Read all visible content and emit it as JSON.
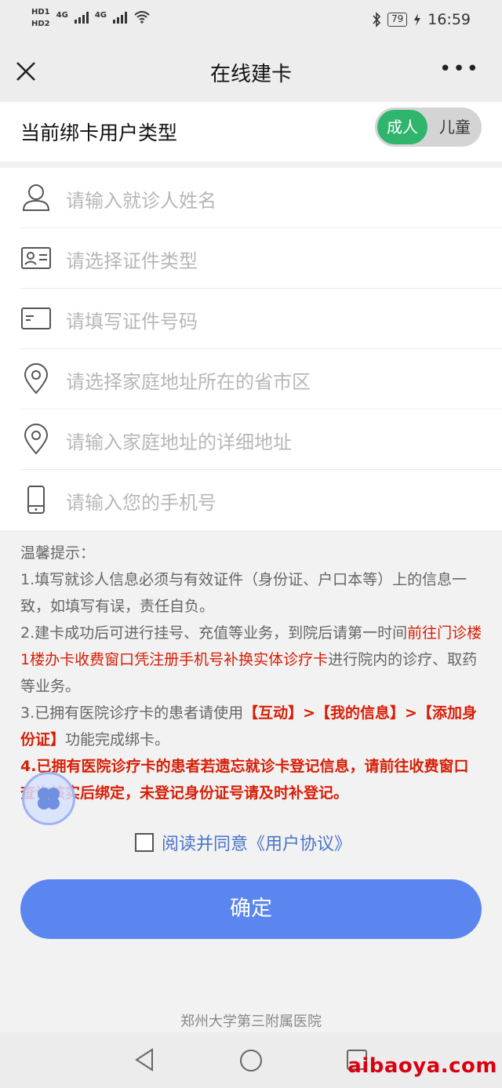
{
  "status_bar": {
    "hd1": "HD1",
    "hd2": "HD2",
    "net1": "4G",
    "net2": "4G",
    "battery": "79",
    "time": "16:59",
    "icons": [
      "signal-icon",
      "wifi-icon",
      "bluetooth-icon",
      "battery-icon",
      "charging-icon"
    ]
  },
  "nav": {
    "title": "在线建卡",
    "close_icon": "close-icon",
    "more_label": "•••"
  },
  "user_type": {
    "label": "当前绑卡用户类型",
    "options": [
      "成人",
      "儿童"
    ],
    "selected": "成人",
    "accent": "#2fb56c"
  },
  "form": {
    "fields": [
      {
        "icon": "user-icon",
        "placeholder": "请输入就诊人姓名"
      },
      {
        "icon": "id-card-icon",
        "placeholder": "请选择证件类型"
      },
      {
        "icon": "card-icon",
        "placeholder": "请填写证件号码"
      },
      {
        "icon": "location-icon",
        "placeholder": "请选择家庭地址所在的省市区"
      },
      {
        "icon": "location-icon",
        "placeholder": "请输入家庭地址的详细地址"
      },
      {
        "icon": "phone-icon",
        "placeholder": "请输入您的手机号"
      }
    ]
  },
  "notice": {
    "title": "温馨提示：",
    "item1": "1.填写就诊人信息必须与有效证件（身份证、户口本等）上的信息一致，如填写有误，责任自负。",
    "item2_a": "2.建卡成功后可进行挂号、充值等业务，到院后请第一时间",
    "item2_b": "前往门诊楼1楼办卡收费窗口",
    "item2_c": "凭注册手机号",
    "item2_d": "补换实体诊疗卡",
    "item2_e": "进行院内的诊疗、取药等业务。",
    "item3_a": "3.已拥有医院诊疗卡的患者请使用",
    "item3_b": "【互动】>【我的信息】>【添加身份证】",
    "item3_c": "功能完成绑卡。",
    "item4": "4.已拥有医院诊疗卡的患者若遗忘就诊卡登记信息，请前往收费窗口查询核实后绑定，未登记身份证号请及时补登记。",
    "highlight_color": "#d81e06"
  },
  "agreement": {
    "checked": false,
    "label": "阅读并同意《用户协议》"
  },
  "confirm_label": "确定",
  "footer": "郑州大学第三附属医院",
  "watermark": "aibaoya.com"
}
